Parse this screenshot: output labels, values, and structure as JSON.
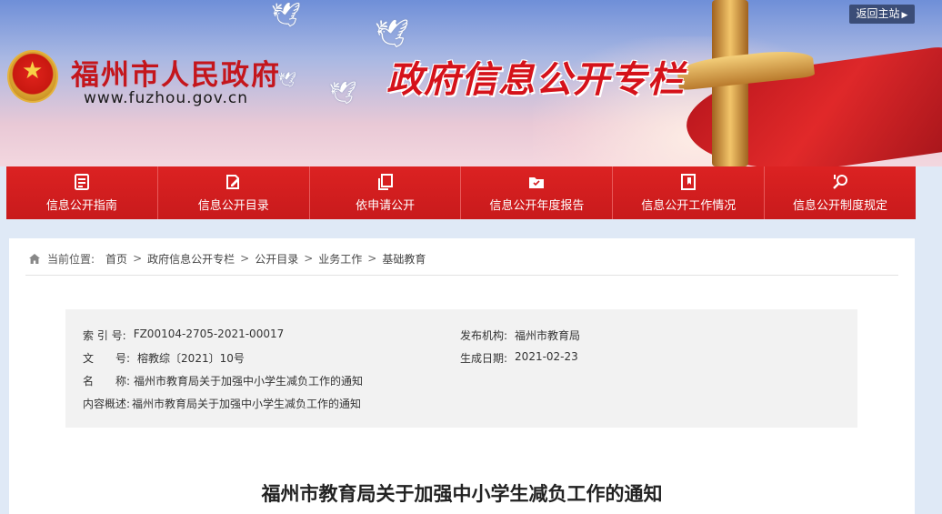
{
  "header": {
    "site_name": "福州市人民政府",
    "site_url": "www.fuzhou.gov.cn",
    "banner_title": "政府信息公开专栏",
    "return_label": "返回主站"
  },
  "nav": {
    "items": [
      {
        "label": "信息公开指南",
        "icon": "document-list-icon"
      },
      {
        "label": "信息公开目录",
        "icon": "edit-document-icon"
      },
      {
        "label": "依申请公开",
        "icon": "copy-document-icon"
      },
      {
        "label": "信息公开年度报告",
        "icon": "folder-icon"
      },
      {
        "label": "信息公开工作情况",
        "icon": "file-flag-icon"
      },
      {
        "label": "信息公开制度规定",
        "icon": "search-key-icon"
      }
    ]
  },
  "breadcrumb": {
    "prefix": "当前位置:",
    "items": [
      "首页",
      "政府信息公开专栏",
      "公开目录",
      "业务工作",
      "基础教育"
    ],
    "separator": ">"
  },
  "meta": {
    "index_label": "索 引 号:",
    "index_value": "FZ00104-2705-2021-00017",
    "publisher_label": "发布机构:",
    "publisher_value": "福州市教育局",
    "docno_label": "文　　号:",
    "docno_value": "榕教综〔2021〕10号",
    "date_label": "生成日期:",
    "date_value": "2021-02-23",
    "name_label": "名　　称:",
    "name_value": "福州市教育局关于加强中小学生减负工作的通知",
    "summary_label": "内容概述:",
    "summary_value": "福州市教育局关于加强中小学生减负工作的通知"
  },
  "document": {
    "title": "福州市教育局关于加强中小学生减负工作的通知"
  },
  "colors": {
    "nav_red": "#d41e20",
    "brand_red": "#c4161c",
    "return_bg": "#3b4d77"
  }
}
